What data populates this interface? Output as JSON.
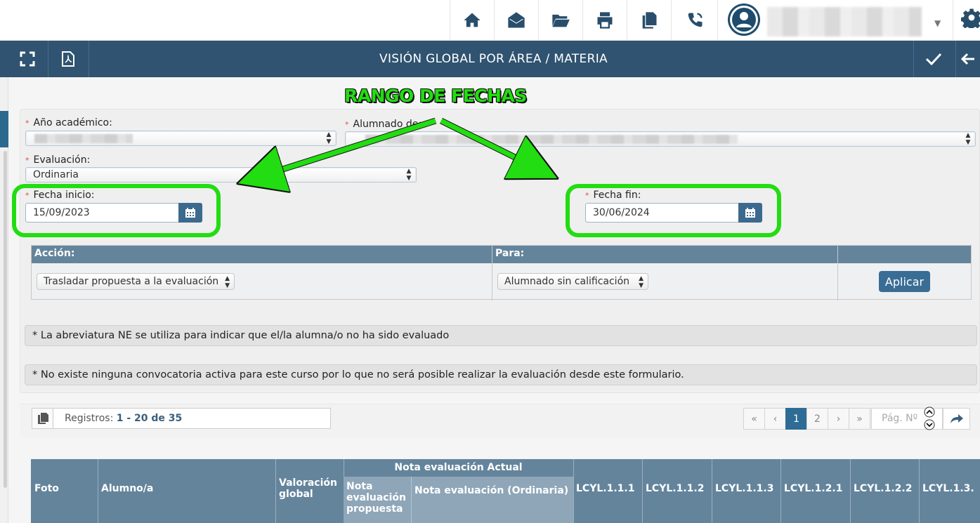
{
  "toolbar": {
    "icons": [
      "home-icon",
      "envelope-open-icon",
      "folder-open-icon",
      "printer-icon",
      "copy-icon",
      "phone-icon"
    ],
    "accent": "#284e6b"
  },
  "header": {
    "title": "VISIÓN GLOBAL POR ÁREA / MATERIA",
    "bar_color": "#2f5370"
  },
  "annotation": {
    "label": "RANGO DE FECHAS",
    "color": "#22dd11"
  },
  "form": {
    "academic_year": {
      "label": "Año académico:",
      "value": ""
    },
    "students": {
      "label": "Alumnado de:",
      "value": ""
    },
    "evaluation": {
      "label": "Evaluación:",
      "value": "Ordinaria"
    },
    "start_date": {
      "label": "Fecha inicio:",
      "value": "15/09/2023"
    },
    "end_date": {
      "label": "Fecha fin:",
      "value": "30/06/2024"
    },
    "required_mark": "*"
  },
  "action_table": {
    "action_header": "Acción:",
    "for_header": "Para:",
    "action_value": "Trasladar propuesta a la evaluación",
    "for_value": "Alumnado sin calificación",
    "apply_label": "Aplicar"
  },
  "notes": [
    "* La abreviatura NE se utiliza para indicar que el/la alumna/o no ha sido evaluado",
    "* No existe ninguna convocatoria activa para este curso por lo que no será posible realizar la evaluación desde este formulario."
  ],
  "records": {
    "prefix": "Registros:",
    "range": "1 - 20 de 35"
  },
  "pagination": {
    "first": "«",
    "prev": "‹",
    "pages": [
      "1",
      "2"
    ],
    "current": "1",
    "next": "›",
    "last": "»",
    "page_placeholder": "Pág. Nº"
  },
  "table": {
    "columns": {
      "photo": "Foto",
      "student": "Alumno/a",
      "global": "Valoración global",
      "current_group": "Nota evaluación Actual",
      "proposed": "Nota evaluación propuesta",
      "ordinary": "Nota evaluación (Ordinaria)",
      "c1": "LCYL.1.1.1",
      "c2": "LCYL.1.1.2",
      "c3": "LCYL.1.1.3",
      "c4": "LCYL.1.2.1",
      "c5": "LCYL.1.2.2",
      "c6": "LCYL.1.3."
    }
  }
}
